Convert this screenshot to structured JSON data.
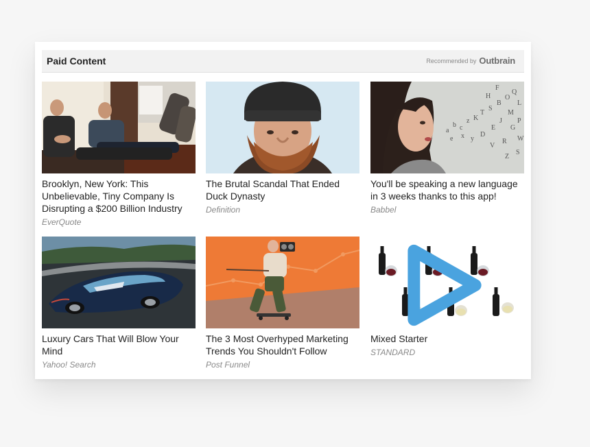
{
  "widget": {
    "title": "Paid Content",
    "recommended_by": "Recommended by",
    "brand": "Outbrain"
  },
  "cards": [
    {
      "headline": "Brooklyn, New York: This Unbelievable, Tiny Company Is Disrupting a $200 Billion Industry",
      "source": "EverQuote",
      "image": "office-feet-on-desk"
    },
    {
      "headline": "The Brutal Scandal That Ended Duck Dynasty",
      "source": "Definition",
      "image": "bearded-man-beanie"
    },
    {
      "headline": "You'll be speaking a new language in 3 weeks thanks to this app!",
      "source": "Babbel",
      "image": "woman-letters"
    },
    {
      "headline": "Luxury Cars That Will Blow Your Mind",
      "source": "Yahoo! Search",
      "image": "concept-car"
    },
    {
      "headline": "The 3 Most Overhyped Marketing Trends You Shouldn't Follow",
      "source": "Post Funnel",
      "image": "skateboarder-boombox"
    },
    {
      "headline": "Mixed Starter",
      "source": "STANDARD",
      "image": "wine-bottles"
    }
  ],
  "colors": {
    "accent_adchoice": "#4aa3df",
    "header_bg": "#f2f2f2"
  }
}
